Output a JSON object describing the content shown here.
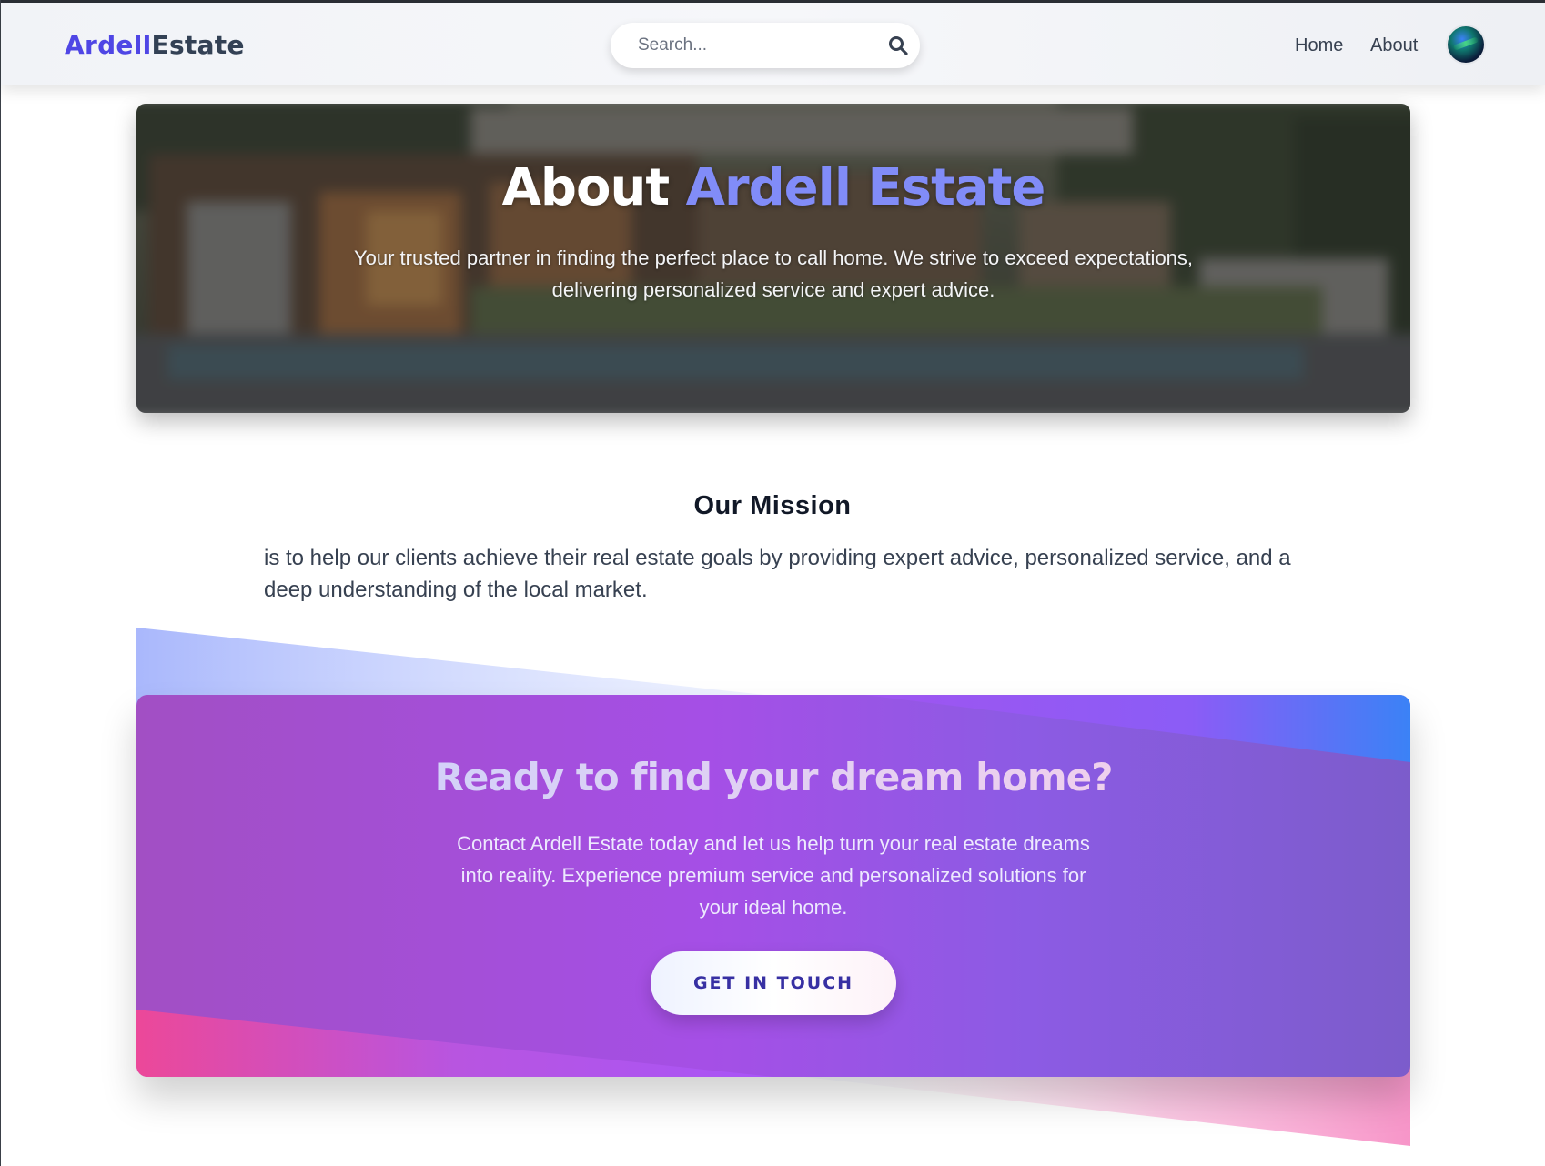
{
  "header": {
    "logo_primary": "Ardell",
    "logo_secondary": "Estate",
    "search_placeholder": "Search...",
    "nav": {
      "home": "Home",
      "about": "About"
    }
  },
  "hero": {
    "title_white": "About ",
    "title_accent": "Ardell Estate",
    "subtitle": "Your trusted partner in finding the perfect place to call home. We strive to exceed expectations, delivering personalized service and expert advice."
  },
  "mission": {
    "title": "Our Mission",
    "text": "is to help our clients achieve their real estate goals by providing expert advice, personalized service, and a deep understanding of the local market."
  },
  "cta": {
    "title": "Ready to find your dream home?",
    "text": "Contact Ardell Estate today and let us help turn your real estate dreams into reality. Experience premium service and personalized solutions for your ideal home.",
    "button": "GET IN TOUCH"
  },
  "colors": {
    "brand": "#4f46e5",
    "accent": "#818cf8",
    "cta_purple": "#a855f7",
    "cta_pink": "#ec4899",
    "cta_blue": "#3b82f6"
  }
}
